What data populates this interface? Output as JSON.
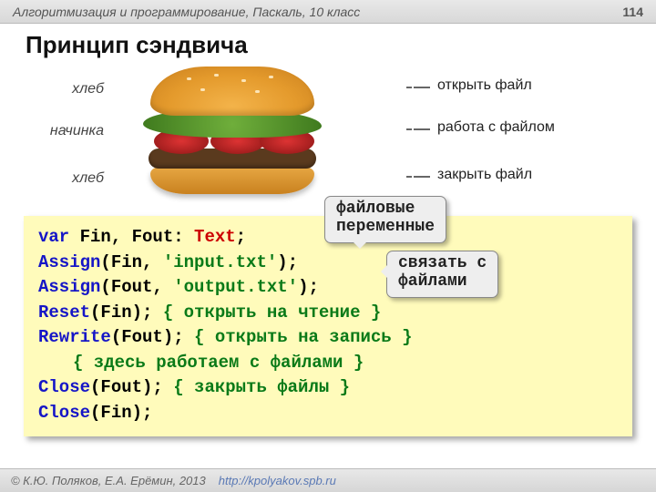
{
  "header": {
    "course": "Алгоритмизация и программирование, Паскаль, 10 класс",
    "page": "114"
  },
  "title": "Принцип сэндвича",
  "sandwich": {
    "top": "хлеб",
    "mid": "начинка",
    "bot": "хлеб"
  },
  "actions": {
    "open": "открыть файл",
    "work": "работа с  файлом",
    "close": "закрыть файл"
  },
  "callouts": {
    "vars": "файловые\nпеременные",
    "bind": "связать с\nфайлами"
  },
  "code": {
    "l1": {
      "kw": "var",
      "ids": " Fin, Fout: ",
      "ty": "Text",
      "sc": ";"
    },
    "l2": {
      "fn": "Assign",
      "p1": "(Fin, ",
      "s": "'input.txt'",
      "p2": ");"
    },
    "l3": {
      "fn": "Assign",
      "p1": "(Fout, ",
      "s": "'output.txt'",
      "p2": ");"
    },
    "l4": {
      "fn": "Reset",
      "p": "(Fin);    ",
      "cm": "{ открыть на чтение }"
    },
    "l5": {
      "fn": "Rewrite",
      "p": "(Fout); ",
      "cm": "{ открыть на запись }"
    },
    "l6": {
      "cm": "{ здесь работаем с файлами }"
    },
    "l7": {
      "fn": "Close",
      "p": "(Fout);   ",
      "cm": "{ закрыть файлы }"
    },
    "l8": {
      "fn": "Close",
      "p": "(Fin);"
    }
  },
  "footer": {
    "copyright": "© К.Ю. Поляков, Е.А. Ерёмин, 2013",
    "url": "http://kpolyakov.spb.ru"
  }
}
